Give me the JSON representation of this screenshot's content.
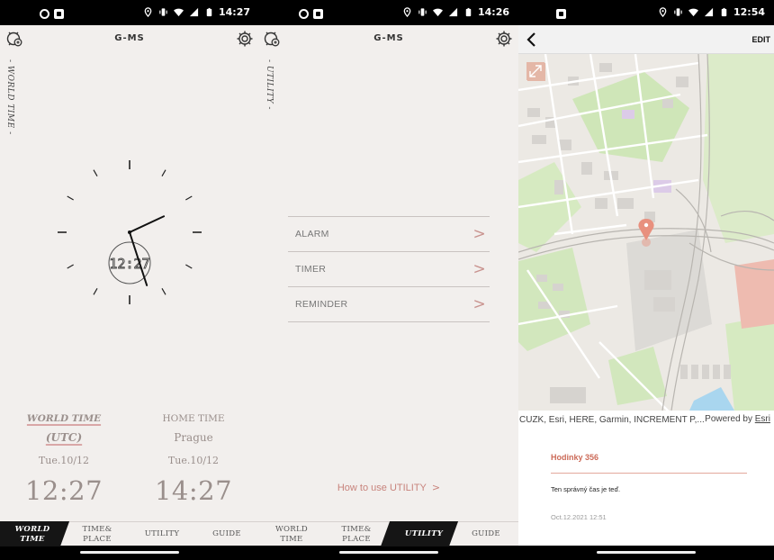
{
  "screens": [
    {
      "status_time": "14:27",
      "brand": "G-MS",
      "side_label": "- WORLD TIME -",
      "clock": {
        "digital": "12:27",
        "hour_angle": 65,
        "minute_angle": 162
      },
      "world": {
        "label": "WORLD TIME",
        "city": "(UTC)",
        "date": "Tue.10/12",
        "time": "12:27"
      },
      "home": {
        "label": "HOME TIME",
        "city": "Prague",
        "date": "Tue.10/12",
        "time": "14:27"
      },
      "tabs": [
        {
          "line1": "WORLD",
          "line2": "TIME"
        },
        {
          "line1": "TIME&",
          "line2": "PLACE"
        },
        {
          "line1": "UTILITY",
          "line2": ""
        },
        {
          "line1": "GUIDE",
          "line2": ""
        }
      ]
    },
    {
      "status_time": "14:26",
      "brand": "G-MS",
      "side_label": "- UTILITY -",
      "menu": [
        {
          "label": "ALARM"
        },
        {
          "label": "TIMER"
        },
        {
          "label": "REMINDER"
        }
      ],
      "chevron": ">",
      "how_to": "How to use UTILITY",
      "tabs": [
        {
          "line1": "WORLD",
          "line2": "TIME"
        },
        {
          "line1": "TIME&",
          "line2": "PLACE"
        },
        {
          "line1": "UTILITY",
          "line2": ""
        },
        {
          "line1": "GUIDE",
          "line2": ""
        }
      ]
    },
    {
      "status_time": "12:54",
      "edit_label": "EDIT",
      "attribution": "CUZK, Esri, HERE, Garmin, INCREMENT P,...",
      "powered_by": "Powered by",
      "esri": "Esri",
      "note": {
        "title": "Hodinky 356",
        "body": "Ten správný čas je teď.",
        "date": "Oct.12.2021 12:51"
      }
    }
  ],
  "colors": {
    "accent": "#c8837c",
    "map_road": "#ffffff",
    "map_park": "#cfe6b8",
    "map_building": "#d9d9d9"
  }
}
